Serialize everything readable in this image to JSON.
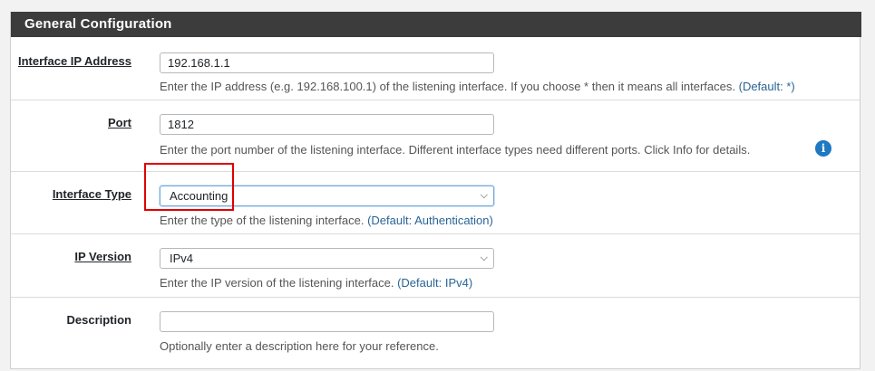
{
  "panel": {
    "title": "General Configuration"
  },
  "fields": {
    "ip_address": {
      "label": "Interface IP Address",
      "value": "192.168.1.1",
      "help": "Enter the IP address (e.g. 192.168.100.1) of the listening interface. If you choose * then it means all interfaces.",
      "default": "(Default: *)"
    },
    "port": {
      "label": "Port",
      "value": "1812",
      "help": "Enter the port number of the listening interface. Different interface types need different ports. Click Info for details.",
      "info_icon": "info-icon"
    },
    "interface_type": {
      "label": "Interface Type",
      "value": "Accounting",
      "help": "Enter the type of the listening interface.",
      "default": "(Default: Authentication)"
    },
    "ip_version": {
      "label": "IP Version",
      "value": "IPv4",
      "help": "Enter the IP version of the listening interface.",
      "default": "(Default: IPv4)"
    },
    "description": {
      "label": "Description",
      "value": "",
      "help": "Optionally enter a description here for your reference."
    }
  },
  "colors": {
    "header_bg": "#3c3c3c",
    "link": "#2a6496",
    "info_icon": "#1e78c2",
    "highlight_box": "#e00000"
  }
}
